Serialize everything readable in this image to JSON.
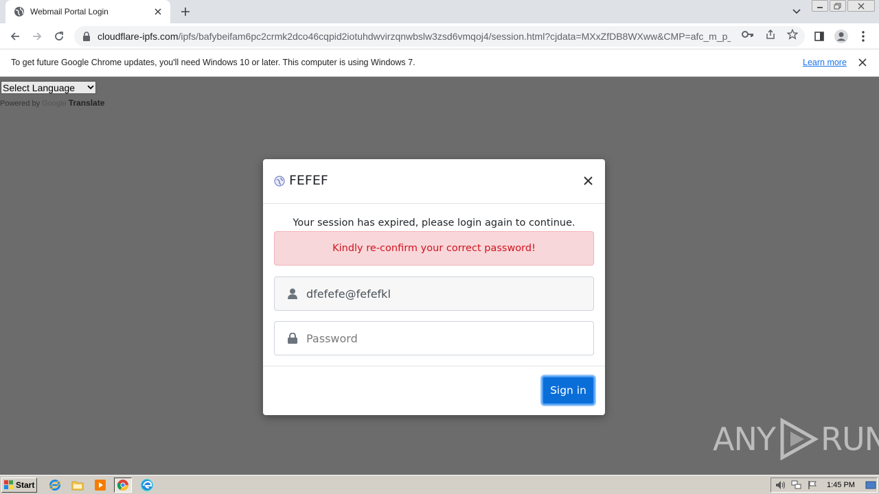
{
  "browser": {
    "tab_title": "Webmail Portal Login",
    "url_host": "cloudflare-ipfs.com",
    "url_path": "/ipfs/bafybeifam6pc2crmk2dco46cqpid2iotuhdwvirzqnwbslw3zsd6vmqoj4/session.html?cjdata=MXxZfDB8WXww&CMP=afc_m_p_..."
  },
  "infobar": {
    "message": "To get future Google Chrome updates, you'll need Windows 10 or later. This computer is using Windows 7.",
    "learn_more": "Learn more"
  },
  "page": {
    "language_select": "Select Language",
    "powered_by": "Powered by",
    "google": "Google",
    "translate": "Translate"
  },
  "modal": {
    "title": "FEFEF",
    "session_message": "Your session has expired, please login again to continue.",
    "alert": "Kindly re-confirm your correct password!",
    "username_value": "dfefefe@fefefkl",
    "password_placeholder": "Password",
    "signin_label": "Sign in"
  },
  "watermark": {
    "left": "ANY",
    "right": "RUN"
  },
  "taskbar": {
    "start_label": "Start",
    "clock": "1:45 PM"
  },
  "colors": {
    "signin_bg": "#0a6ed8",
    "alert_bg": "#f8d7da",
    "alert_text": "#d0141f",
    "overlay": "#6c6c6c"
  }
}
